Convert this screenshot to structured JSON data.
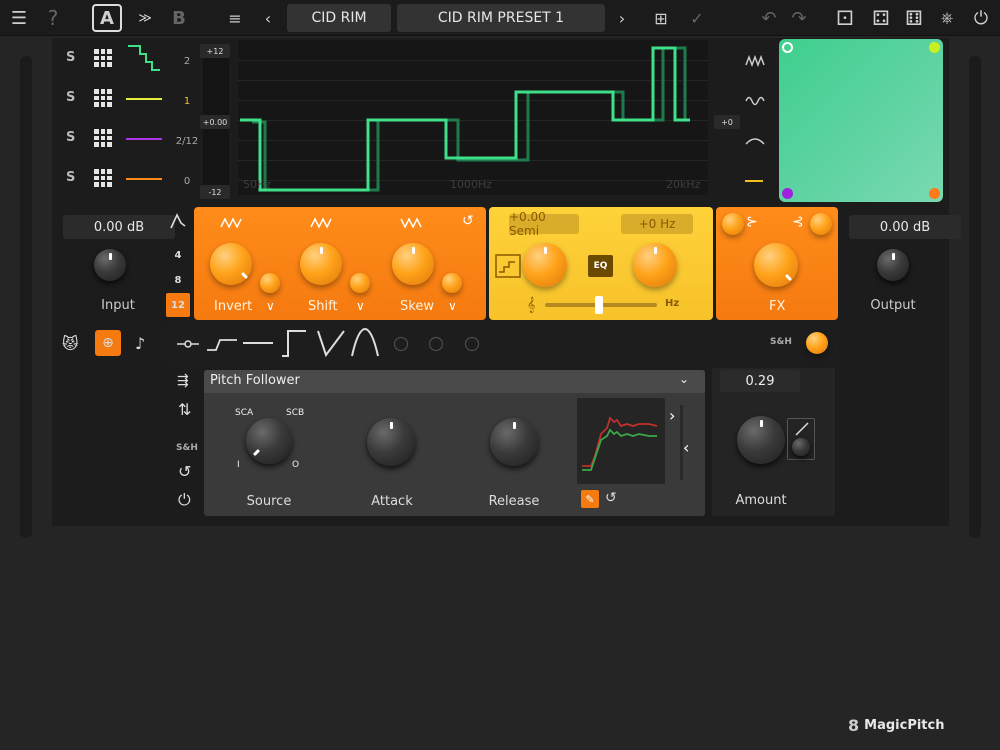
{
  "toolbar": {
    "preset_bank": "CID RIM",
    "preset_name": "CID RIM PRESET 1",
    "slot_a": "A",
    "slot_b": "B",
    "help": "?"
  },
  "bands": [
    {
      "solo": "S",
      "color": "#3ee08a"
    },
    {
      "solo": "S",
      "color": "#e6f03a"
    },
    {
      "solo": "S",
      "color": "#b035e6"
    },
    {
      "solo": "S",
      "color": "#ff8a1a"
    }
  ],
  "band_scale": [
    "2",
    "1",
    "2/12",
    "0"
  ],
  "meter": {
    "top": "+12",
    "mid": "+0.00",
    "bottom": "-12",
    "right": "+0"
  },
  "graph": {
    "freq_labels": [
      "50Hz",
      "1000Hz",
      "20kHz"
    ]
  },
  "input": {
    "value": "0.00 dB",
    "label": "Input"
  },
  "output": {
    "value": "0.00 dB",
    "label": "Output"
  },
  "pitch_tabs": [
    "4",
    "8",
    "12"
  ],
  "fx_modules": {
    "invert": "Invert",
    "shift": "Shift",
    "skew": "Skew",
    "semi": "+0.00 Semi",
    "hz_offset": "+0 Hz",
    "eq": "EQ",
    "hz_unit": "Hz",
    "fx": "FX"
  },
  "mod": {
    "source_select": "Pitch Follower",
    "sh_label": "S&H",
    "sh_strip": "S&H",
    "source": "Source",
    "attack": "Attack",
    "release": "Release",
    "sca": "SCA",
    "scb": "SCB",
    "i": "I",
    "o": "O",
    "amount_value": "0.29",
    "amount_label": "Amount"
  },
  "logo": "MagicPitch",
  "colors": {
    "accent_orange": "#f57a10",
    "accent_yellow": "#f7c22a",
    "graph_line": "#3ee08a",
    "xy_pad": "#5fd3a2"
  }
}
